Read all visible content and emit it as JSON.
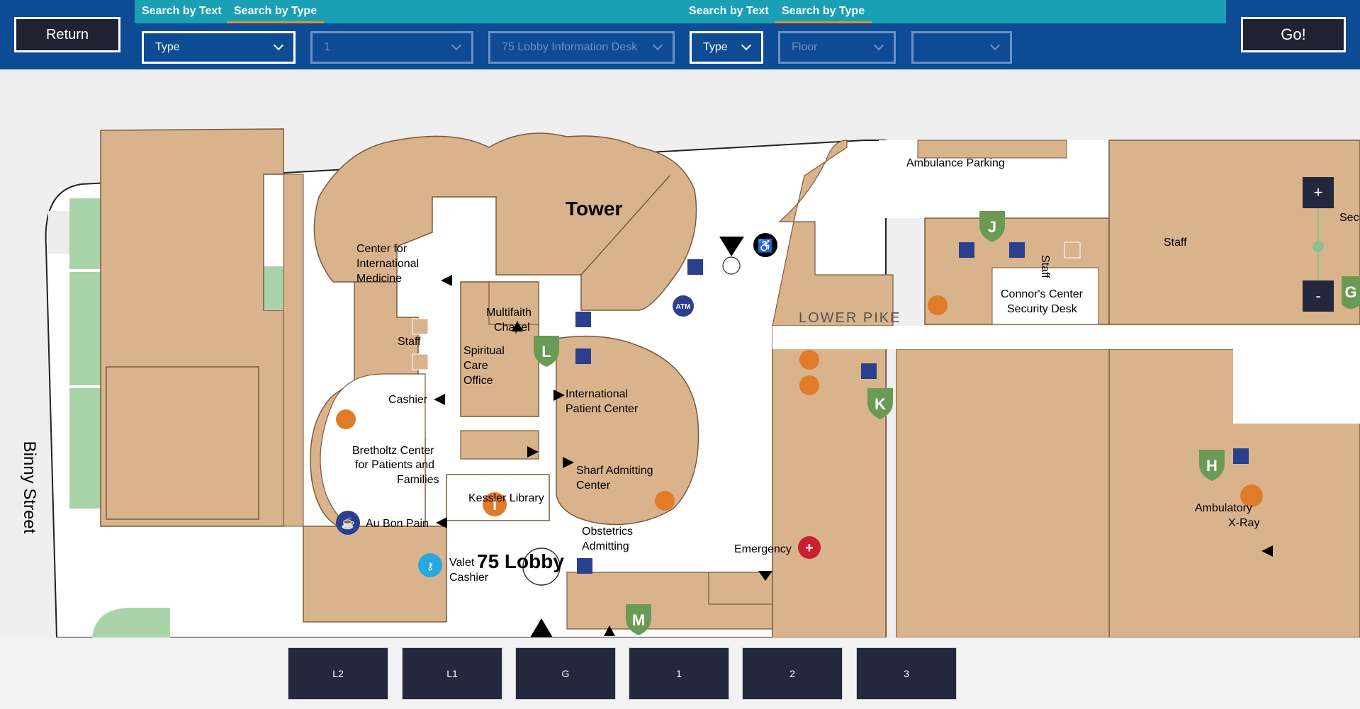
{
  "header": {
    "return_label": "Return",
    "go_label": "Go!",
    "left_tabs": [
      "Search by Text",
      "Search by Type"
    ],
    "right_tabs": [
      "Search by Text",
      "Search by Type"
    ],
    "left_dropdowns": [
      {
        "value": "Type",
        "enabled": true
      },
      {
        "value": "1",
        "enabled": false
      },
      {
        "value": "75 Lobby Information Desk",
        "enabled": false
      }
    ],
    "right_dropdowns": [
      {
        "value": "Type",
        "enabled": true
      },
      {
        "value": "Floor",
        "enabled": false
      },
      {
        "value": "",
        "enabled": false
      }
    ]
  },
  "map": {
    "street_label": "Binny Street",
    "tower_label": "Tower",
    "lobby_label": "75 Lobby",
    "lower_pike_label": "LOWER PIKE",
    "ambulance_parking_label": "Ambulance Parking",
    "labels": {
      "center_intl_medicine": [
        "Center for",
        "International",
        "Medicine"
      ],
      "multifaith_chapel": [
        "Multifaith",
        "Chapel"
      ],
      "spiritual_care": [
        "Spiritual",
        "Care",
        "Office"
      ],
      "staff_left": "Staff",
      "cashier": "Cashier",
      "intl_patient_center": [
        "International",
        "Patient Center"
      ],
      "bretholtz": [
        "Bretholtz Center",
        "for Patients and",
        "Families"
      ],
      "sharf_admitting": [
        "Sharf Admitting",
        "Center"
      ],
      "kessler_library": "Kessler Library",
      "obstetrics": [
        "Obstetrics",
        "Admitting"
      ],
      "au_bon_pain": "Au Bon Pain",
      "valet_cashier": [
        "Valet",
        "Cashier"
      ],
      "emergency": "Emergency",
      "connors_center": [
        "Connor's Center",
        "Security Desk"
      ],
      "staff_mid": "Staff",
      "staff_right": "Staff",
      "ambulatory_xray": [
        "Ambulatory",
        "X-Ray"
      ],
      "secu_partial": "Secu"
    },
    "elevator_letters": [
      "J",
      "L",
      "K",
      "H",
      "M",
      "G"
    ],
    "atm_label": "ATM",
    "info_label": "i",
    "zoom_in": "+",
    "zoom_out": "-"
  },
  "floors": [
    "L2",
    "L1",
    "G",
    "1",
    "2",
    "3"
  ],
  "colors": {
    "header_bg": "#0d4c94",
    "tab_bg": "#1aa0b4",
    "tab_underline": "#e0902e",
    "button_dark": "#1f2233",
    "building": "#d9b38c",
    "building_stroke": "#7a5a3a",
    "corridor": "#ffffff",
    "green_marker": "#6b9a55",
    "elevator_blue": "#2a3f8e",
    "orange_icon": "#e07b2a",
    "emergency_red": "#c8202f"
  }
}
